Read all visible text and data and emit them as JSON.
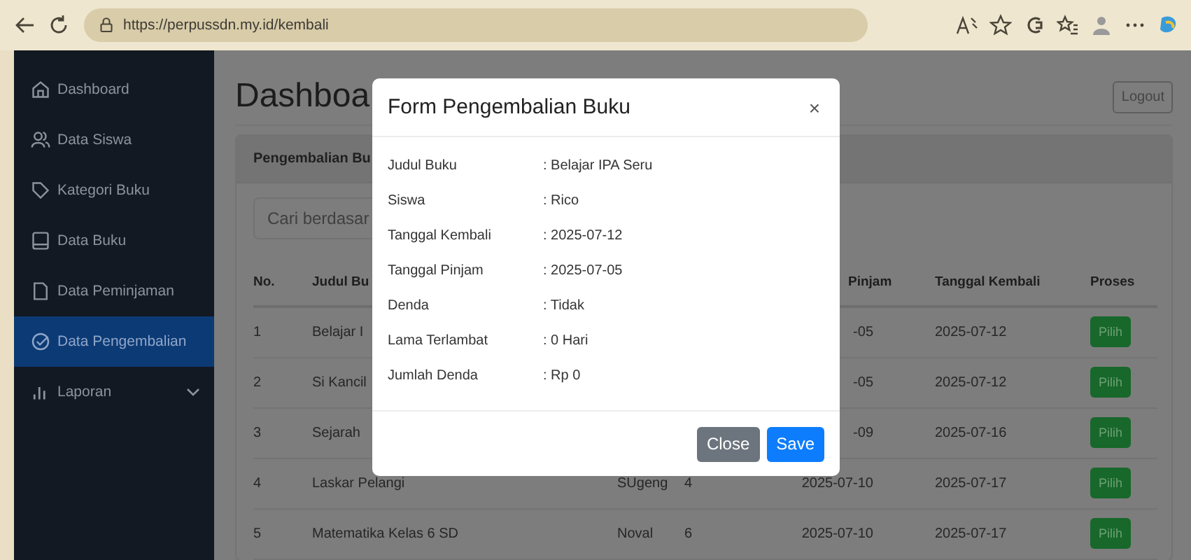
{
  "browser": {
    "url": "https://perpussdn.my.id/kembali"
  },
  "sidebar": {
    "items": [
      {
        "label": "Dashboard",
        "selected": false,
        "kind": "link"
      },
      {
        "label": "Data Siswa",
        "selected": false,
        "kind": "link"
      },
      {
        "label": "Kategori Buku",
        "selected": false,
        "kind": "link"
      },
      {
        "label": "Data Buku",
        "selected": false,
        "kind": "link"
      },
      {
        "label": "Data Peminjaman",
        "selected": false,
        "kind": "link"
      },
      {
        "label": "Data Pengembalian",
        "selected": true,
        "kind": "link"
      },
      {
        "label": "Laporan",
        "selected": false,
        "kind": "dropdown"
      }
    ]
  },
  "page": {
    "title": "Dashboa",
    "logout": "Logout"
  },
  "card": {
    "title": "Pengembalian Bu",
    "search": {
      "placeholder": "Cari berdasar"
    },
    "table": {
      "columns": {
        "no": "No.",
        "title": "Judul Bu",
        "borrowed": "Pinjam",
        "returned": "Tanggal Kembali",
        "action": "Proses"
      },
      "rows": [
        {
          "no": "1",
          "title": "Belajar I",
          "borrowed": "-05",
          "returned": "2025-07-12",
          "action": "Pilih"
        },
        {
          "no": "2",
          "title": "Si Kancil",
          "borrowed": "-05",
          "returned": "2025-07-12",
          "action": "Pilih"
        },
        {
          "no": "3",
          "title": "Sejarah",
          "borrowed": "-09",
          "returned": "2025-07-16",
          "action": "Pilih"
        },
        {
          "no": "4",
          "title": "Laskar Pelangi",
          "student": "SUgeng",
          "count": "4",
          "borrowed": "2025-07-10",
          "returned": "2025-07-17",
          "action": "Pilih"
        },
        {
          "no": "5",
          "title": "Matematika Kelas 6 SD",
          "student": "Noval",
          "count": "6",
          "borrowed": "2025-07-10",
          "returned": "2025-07-17",
          "action": "Pilih"
        }
      ]
    }
  },
  "modal": {
    "title": "Form Pengembalian Buku",
    "close": "×",
    "fields": [
      {
        "label": "Judul Buku",
        "value": ": Belajar IPA Seru"
      },
      {
        "label": "Siswa",
        "value": ": Rico"
      },
      {
        "label": "Tanggal Kembali",
        "value": ": 2025-07-12"
      },
      {
        "label": "Tanggal Pinjam",
        "value": ": 2025-07-05"
      },
      {
        "label": "Denda",
        "value": ": Tidak"
      },
      {
        "label": "Lama Terlambat",
        "value": ": 0 Hari"
      },
      {
        "label": "Jumlah Denda",
        "value": ": Rp 0"
      }
    ],
    "buttons": [
      {
        "label": "Close",
        "kind": "secondary"
      },
      {
        "label": "Save",
        "kind": "primary"
      }
    ]
  }
}
